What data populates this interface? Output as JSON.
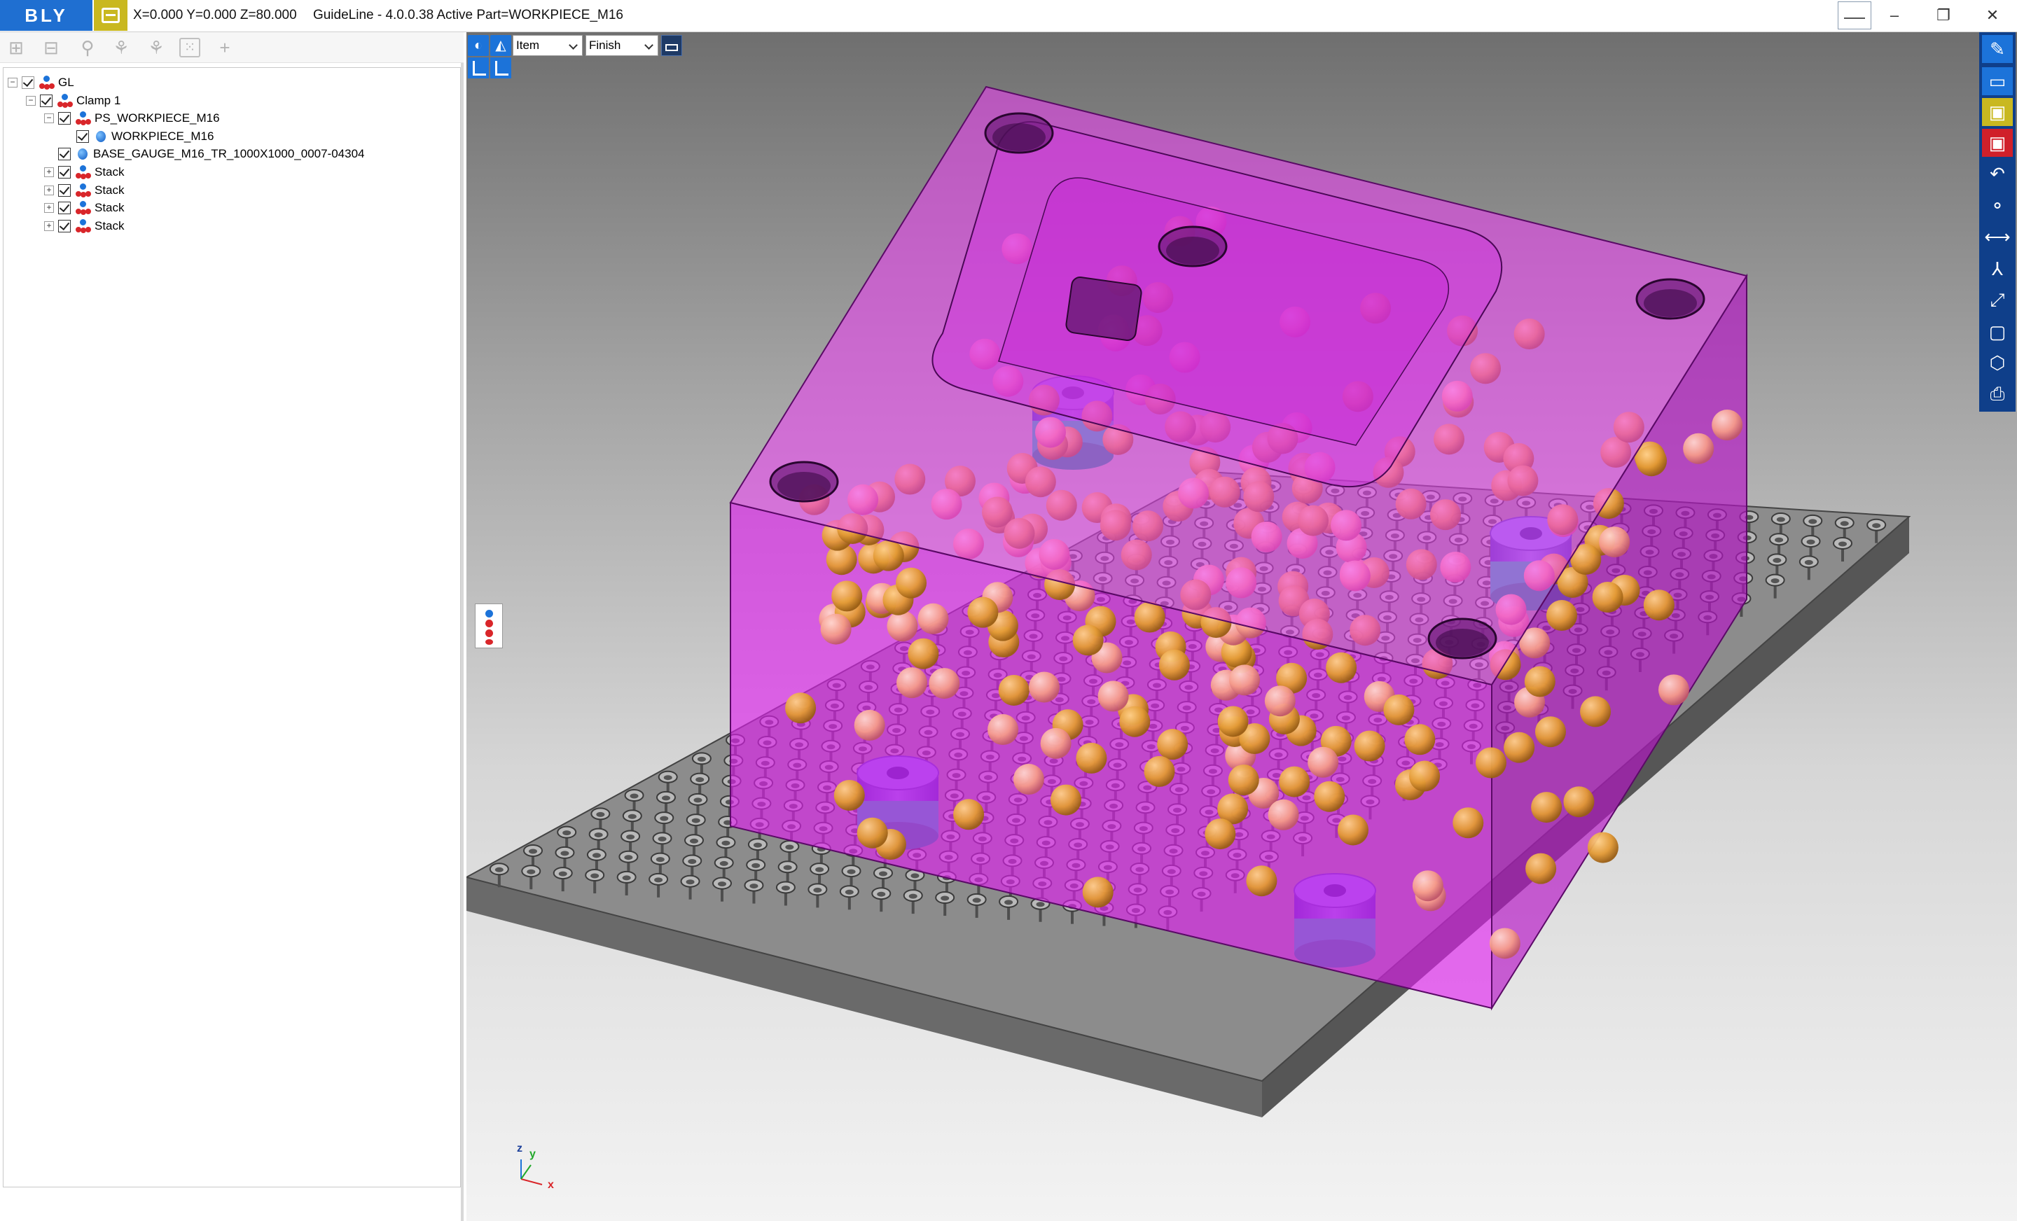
{
  "titlebar": {
    "logo": "BLY",
    "coords": "X=0.000 Y=0.000 Z=80.000",
    "app_title": "GuideLine - 4.0.0.38 Active Part=WORKPIECE_M16",
    "minimize": "–",
    "restore": "❐",
    "close": "✕"
  },
  "tree": [
    {
      "label": "GL",
      "level": 0,
      "icon": "assembly-icon",
      "expander": "minus",
      "checked": true
    },
    {
      "label": "Clamp 1",
      "level": 1,
      "icon": "assembly-icon",
      "expander": "minus",
      "checked": true
    },
    {
      "label": "PS_WORKPIECE_M16",
      "level": 2,
      "icon": "assembly-icon",
      "expander": "minus",
      "checked": true
    },
    {
      "label": "WORKPIECE_M16",
      "level": 3,
      "icon": "part-icon",
      "expander": "none",
      "checked": true
    },
    {
      "label": "BASE_GAUGE_M16_TR_1000X1000_0007-04304",
      "level": 2,
      "icon": "part-icon",
      "expander": "none",
      "checked": true
    },
    {
      "label": "Stack",
      "level": 2,
      "icon": "assembly-icon",
      "expander": "plus",
      "checked": true
    },
    {
      "label": "Stack",
      "level": 2,
      "icon": "assembly-icon",
      "expander": "plus",
      "checked": true
    },
    {
      "label": "Stack",
      "level": 2,
      "icon": "assembly-icon",
      "expander": "plus",
      "checked": true
    },
    {
      "label": "Stack",
      "level": 2,
      "icon": "assembly-icon",
      "expander": "plus",
      "checked": true
    }
  ],
  "viewport": {
    "select_mode": "Item",
    "select_finish": "Finish",
    "axis_labels": {
      "x": "x",
      "y": "y",
      "z": "z"
    }
  },
  "colors": {
    "accent": "#1c73d9",
    "workpiece": "#e21df2",
    "base_plate": "#8c8c8c",
    "spheres": "#e6a340",
    "fixture": "#6a6ad8"
  }
}
